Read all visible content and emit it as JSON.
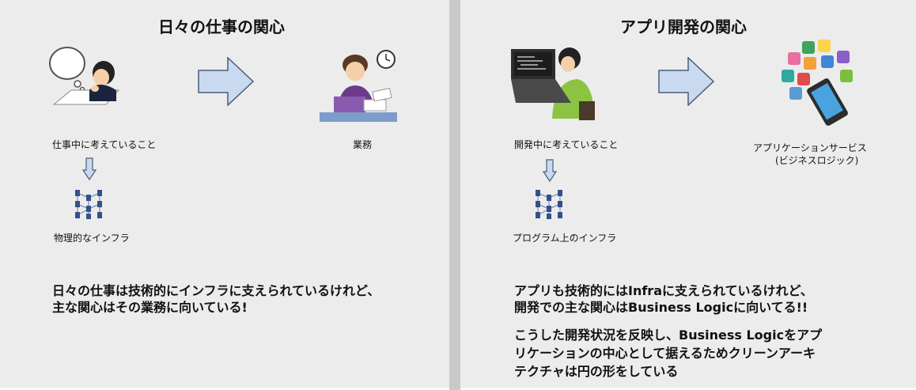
{
  "left": {
    "title": "日々の仕事の関心",
    "thinking_label": "仕事中に考えていること",
    "business_label": "業務",
    "infra_label": "物理的なインフラ",
    "message_line1": "日々の仕事は技術的にインフラに支えられているけれど、",
    "message_line2": "主な関心はその業務に向いている!"
  },
  "right": {
    "title": "アプリ開発の関心",
    "thinking_label": "開発中に考えていること",
    "service_label_line1": "アプリケーションサービス",
    "service_label_line2": "(ビジネスロジック)",
    "infra_label": "プログラム上のインフラ",
    "message_line1": "アプリも技術的にはInfraに支えられているけれど、",
    "message_line2": "開発での主な関心はBusiness Logicに向いてる!!",
    "conclusion_line1": "こうした開発状況を反映し、Business Logicをアプ",
    "conclusion_line2": "リケーションの中心として据えるためクリーンアーキ",
    "conclusion_line3": "テクチャは円の形をしている"
  }
}
